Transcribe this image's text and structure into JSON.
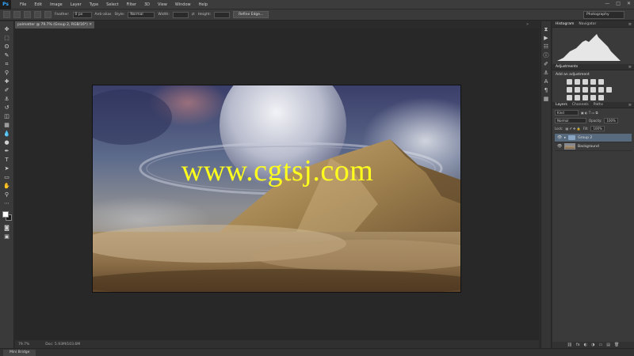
{
  "app": {
    "logo": "Ps"
  },
  "menu": [
    "File",
    "Edit",
    "Image",
    "Layer",
    "Type",
    "Select",
    "Filter",
    "3D",
    "View",
    "Window",
    "Help"
  ],
  "window_controls": [
    "—",
    "□",
    "✕"
  ],
  "options_bar": {
    "feather_label": "Feather:",
    "feather_value": "0 px",
    "antialias_label": "Anti-alias",
    "style_label": "Style:",
    "style_value": "Normal",
    "width_label": "Width:",
    "height_label": "Height:",
    "refine_button": "Refine Edge...",
    "workspace": "Photography"
  },
  "document": {
    "tab_label": "palmatter @ 79.7% (Group 2, RGB/16*)",
    "tab_close": "✕",
    "watermark": "www.cgtsj.com"
  },
  "status": {
    "zoom": "79.7%",
    "doc_info": "Doc: 5.93M/103.6M"
  },
  "bottom": {
    "mini_bridge": "Mini Bridge"
  },
  "panels": {
    "histogram_tabs": [
      "Histogram",
      "Navigator"
    ],
    "adjust_tabs": [
      "Adjustments"
    ],
    "adjust_title": "Add an adjustment",
    "layers_tabs": [
      "Layers",
      "Channels",
      "Paths"
    ],
    "kind_value": "Kind",
    "blend_mode": "Normal",
    "opacity_label": "Opacity:",
    "opacity_value": "100%",
    "lock_label": "Lock:",
    "fill_label": "Fill:",
    "fill_value": "100%",
    "layers": [
      {
        "name": "Group 2",
        "selected": true,
        "type": "group"
      },
      {
        "name": "Background",
        "selected": false,
        "type": "image"
      }
    ],
    "footer_icons": [
      "⛓",
      "fx",
      "◐",
      "◑",
      "▭",
      "▤",
      "🗑"
    ]
  },
  "colors": {
    "watermark": "#ffff1e",
    "selected_layer": "#586a7e",
    "panel_bg": "#3a3a3a",
    "canvas_bg": "#282828"
  }
}
